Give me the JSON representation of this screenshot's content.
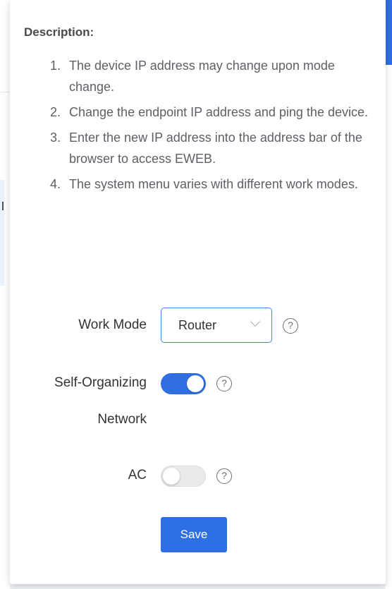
{
  "description": {
    "title": "Description:",
    "items": [
      {
        "num": "1.",
        "text": "The device IP address may change upon mode change."
      },
      {
        "num": "2.",
        "text": "Change the endpoint IP address and ping the device."
      },
      {
        "num": "3.",
        "text": "Enter the new IP address into the address bar of the browser to access EWEB."
      },
      {
        "num": "4.",
        "text": "The system menu varies with different work modes."
      }
    ]
  },
  "form": {
    "work_mode": {
      "label": "Work Mode",
      "value": "Router",
      "help_icon": "question-circle-icon"
    },
    "self_organizing": {
      "label_line1": "Self-Organizing",
      "label_line2": "Network",
      "enabled": true,
      "help_icon": "question-circle-icon"
    },
    "ac": {
      "label": "AC",
      "enabled": false,
      "help_icon": "question-circle-icon"
    },
    "save_label": "Save"
  },
  "colors": {
    "accent": "#2f6fdf",
    "select_border": "#4a86e8",
    "toggle_off": "#e9eaec"
  }
}
